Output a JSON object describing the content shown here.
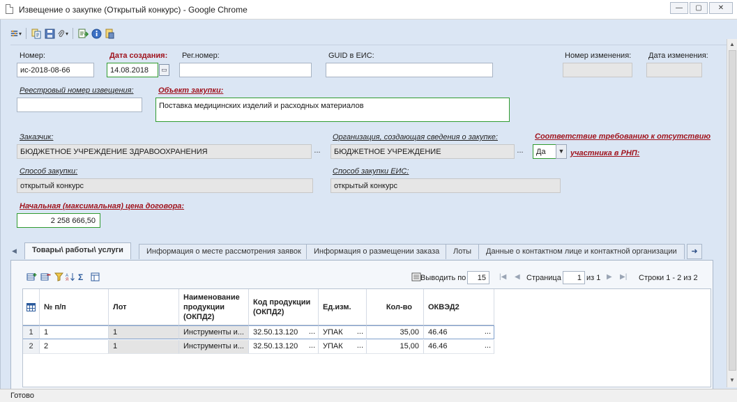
{
  "window": {
    "title": "Извещение о закупке (Открытый конкурс) - Google Chrome",
    "minimize": "—",
    "restore": "▢",
    "close": "✕"
  },
  "toolbar": {
    "items": [
      "tools-icon",
      "copy-icon",
      "save-icon",
      "attach-icon",
      "export-icon",
      "info-icon",
      "sign-icon"
    ]
  },
  "form": {
    "number_label": "Номер:",
    "number_value": "ис-2018-08-66",
    "created_label": "Дата создания:",
    "created_value": "14.08.2018",
    "reg_label": "Рег.номер:",
    "reg_value": "",
    "guid_label": "GUID в ЕИС:",
    "guid_value": "",
    "change_num_label": "Номер изменения:",
    "change_num_value": "",
    "change_date_label": "Дата изменения:",
    "change_date_value": "",
    "registry_label": "Реестровый номер извещения:",
    "registry_value": "",
    "object_label": "Объект закупки:",
    "object_value": "Поставка медицинских изделий и расходных материалов",
    "customer_label": "Заказчик:",
    "customer_value": "БЮДЖЕТНОЕ УЧРЕЖДЕНИЕ ЗДРАВООХРАНЕНИЯ",
    "org_label": "Организация, создающая сведения о закупке:",
    "org_value": "БЮДЖЕТНОЕ УЧРЕЖДЕНИЕ",
    "rnp_label_1": "Соответствие требованию к отсутствию",
    "rnp_label_2": "участника в РНП:",
    "rnp_value": "Да",
    "method_label": "Способ закупки:",
    "method_value": "открытый конкурс",
    "method_eis_label": "Способ закупки ЕИС:",
    "method_eis_value": "открытый конкурс",
    "price_label": "Начальная (максимальная) цена договора:",
    "price_value": "2 258 666,50",
    "dots": "..."
  },
  "tabs": [
    {
      "label": "Товары\\ работы\\ услуги",
      "active": true
    },
    {
      "label": "Информация о месте рассмотрения заявок"
    },
    {
      "label": "Информация о размещении заказа"
    },
    {
      "label": "Лоты"
    },
    {
      "label": "Данные о контактном лице и контактной организации"
    }
  ],
  "pager": {
    "show_label": "Выводить по",
    "show_value": "15",
    "page_label": "Страница",
    "page_value": "1",
    "of_label": "из 1",
    "rows_label": "Строки 1 - 2 из 2"
  },
  "grid": {
    "columns": [
      "№ п/п",
      "Лот",
      "Наименование продукции (ОКПД2)",
      "Код продукции (ОКПД2)",
      "Ед.изм.",
      "Кол-во",
      "ОКВЭД2"
    ],
    "rows": [
      {
        "idx": "1",
        "num": "1",
        "lot": "1",
        "name": "Инструменты и...",
        "code": "32.50.13.120",
        "unit": "УПАК",
        "qty": "35,00",
        "okved": "46.46"
      },
      {
        "idx": "2",
        "num": "2",
        "lot": "1",
        "name": "Инструменты и...",
        "code": "32.50.13.120",
        "unit": "УПАК",
        "qty": "15,00",
        "okved": "46.46"
      }
    ]
  },
  "status": "Готово"
}
